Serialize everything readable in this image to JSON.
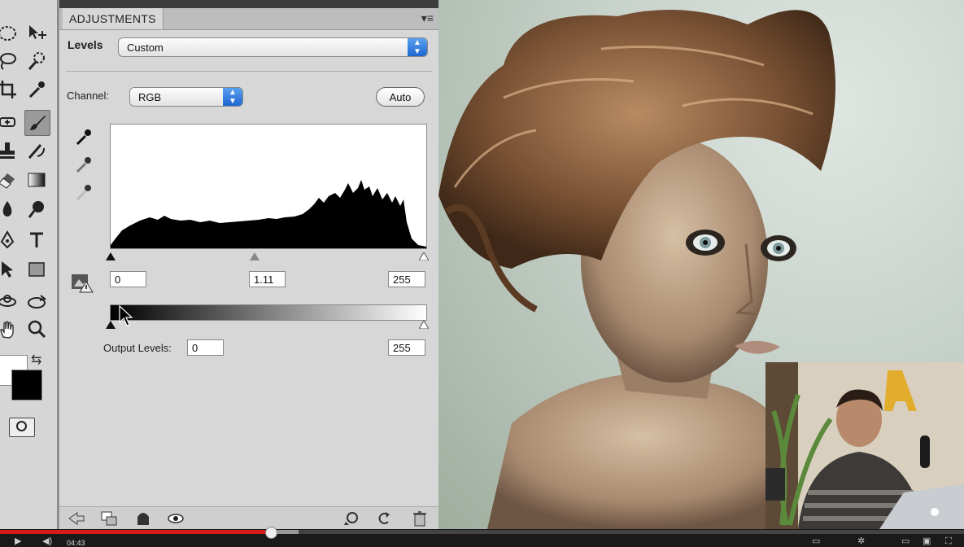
{
  "panel": {
    "tab_label": "ADJUSTMENTS",
    "preset_label": "Levels",
    "preset_value": "Custom",
    "channel_label": "Channel:",
    "channel_value": "RGB",
    "auto_label": "Auto",
    "input_black": "0",
    "input_gamma": "1.11",
    "input_white": "255",
    "output_label": "Output Levels:",
    "output_black": "0",
    "output_white": "255"
  },
  "video": {
    "current_time": "04:43",
    "played_fraction": 0.281,
    "buffered_fraction": 0.31
  },
  "colors": {
    "progress": "#d61b1b",
    "select_arrow": "#1f66d0",
    "panel_bg": "#d7d7d7"
  },
  "icons": {
    "tools": [
      "marquee",
      "move",
      "lasso",
      "quick-select",
      "crop",
      "eyedropper",
      "healing",
      "brush",
      "stamp",
      "history-brush",
      "eraser",
      "gradient",
      "blur",
      "dodge",
      "pen",
      "type",
      "path-select",
      "shape",
      "3d-rotate",
      "3d-orbit",
      "hand",
      "zoom"
    ]
  }
}
